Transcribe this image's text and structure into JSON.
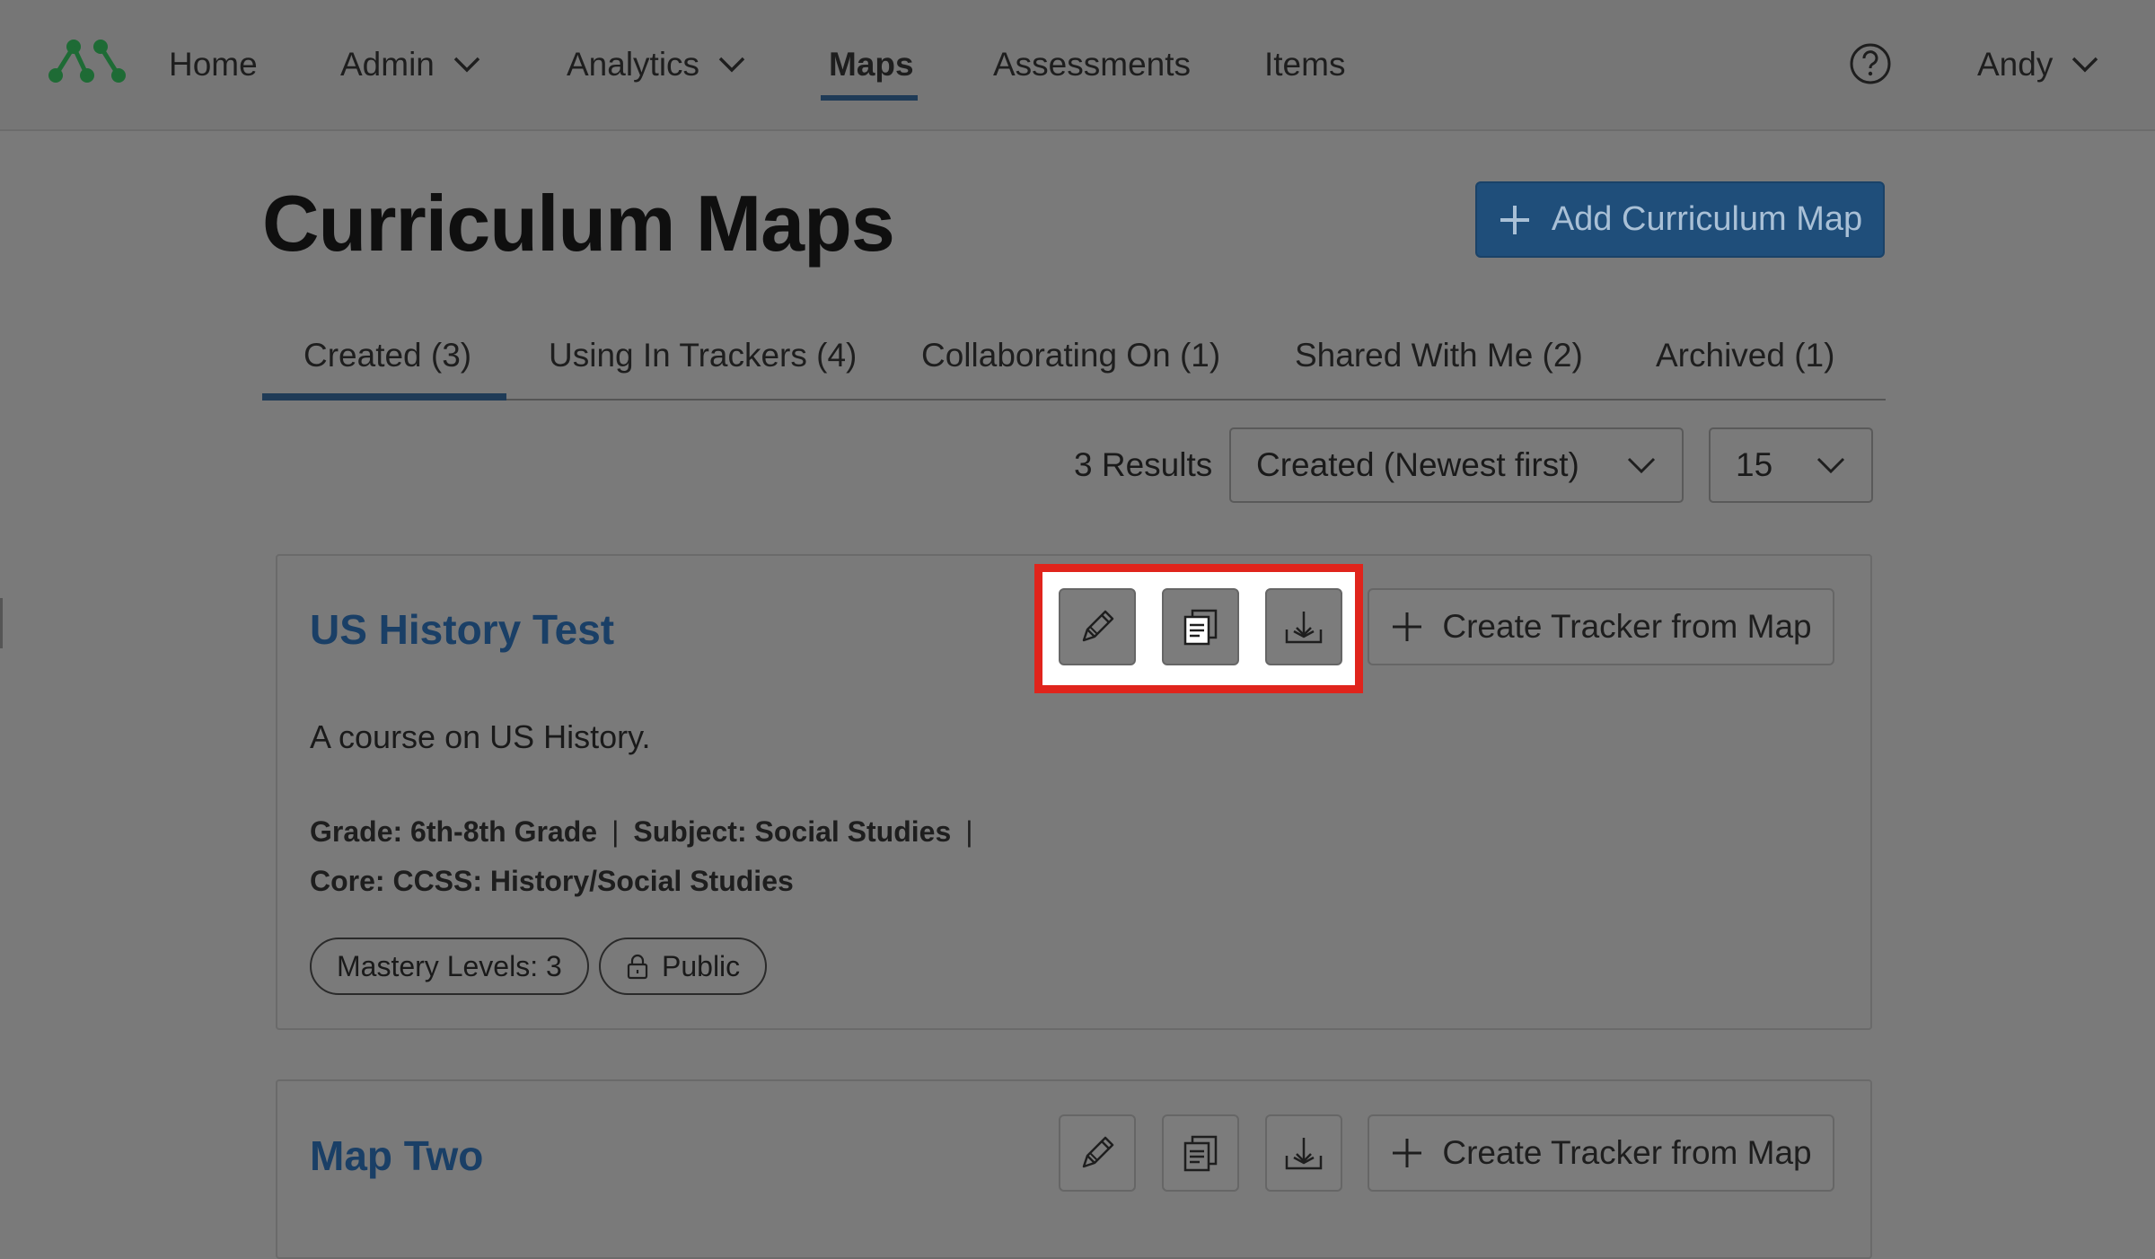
{
  "nav": {
    "items": [
      {
        "label": "Home"
      },
      {
        "label": "Admin"
      },
      {
        "label": "Analytics"
      },
      {
        "label": "Maps"
      },
      {
        "label": "Assessments"
      },
      {
        "label": "Items"
      }
    ],
    "active": "Maps",
    "user": "Andy",
    "logo_color": "#1e6b35"
  },
  "header": {
    "title": "Curriculum Maps",
    "add_button": "Add Curriculum Map",
    "accent": "#1f4e7a"
  },
  "tabs": [
    {
      "label": "Created (3)",
      "selected": true
    },
    {
      "label": "Using In Trackers (4)"
    },
    {
      "label": "Collaborating On (1)"
    },
    {
      "label": "Shared With Me (2)"
    },
    {
      "label": "Archived (1)"
    }
  ],
  "results": {
    "count_label": "3 Results",
    "sort_value": "Created (Newest first)",
    "per_page_value": "15"
  },
  "maps": [
    {
      "title": "US History Test",
      "description": "A course on US History.",
      "grade": "Grade: 6th-8th Grade",
      "subject": "Subject: Social Studies",
      "core": "Core: CCSS: History/Social Studies",
      "mastery": "Mastery Levels: 3",
      "visibility": "Public",
      "tracker_button": "Create Tracker from Map",
      "actions": [
        "pencil-icon",
        "duplicate-icon",
        "download-icon"
      ]
    },
    {
      "title": "Map Two",
      "tracker_button": "Create Tracker from Map",
      "actions": [
        "pencil-icon",
        "duplicate-icon",
        "download-icon"
      ]
    }
  ],
  "separator": "|",
  "highlight_color": "#e0241c"
}
